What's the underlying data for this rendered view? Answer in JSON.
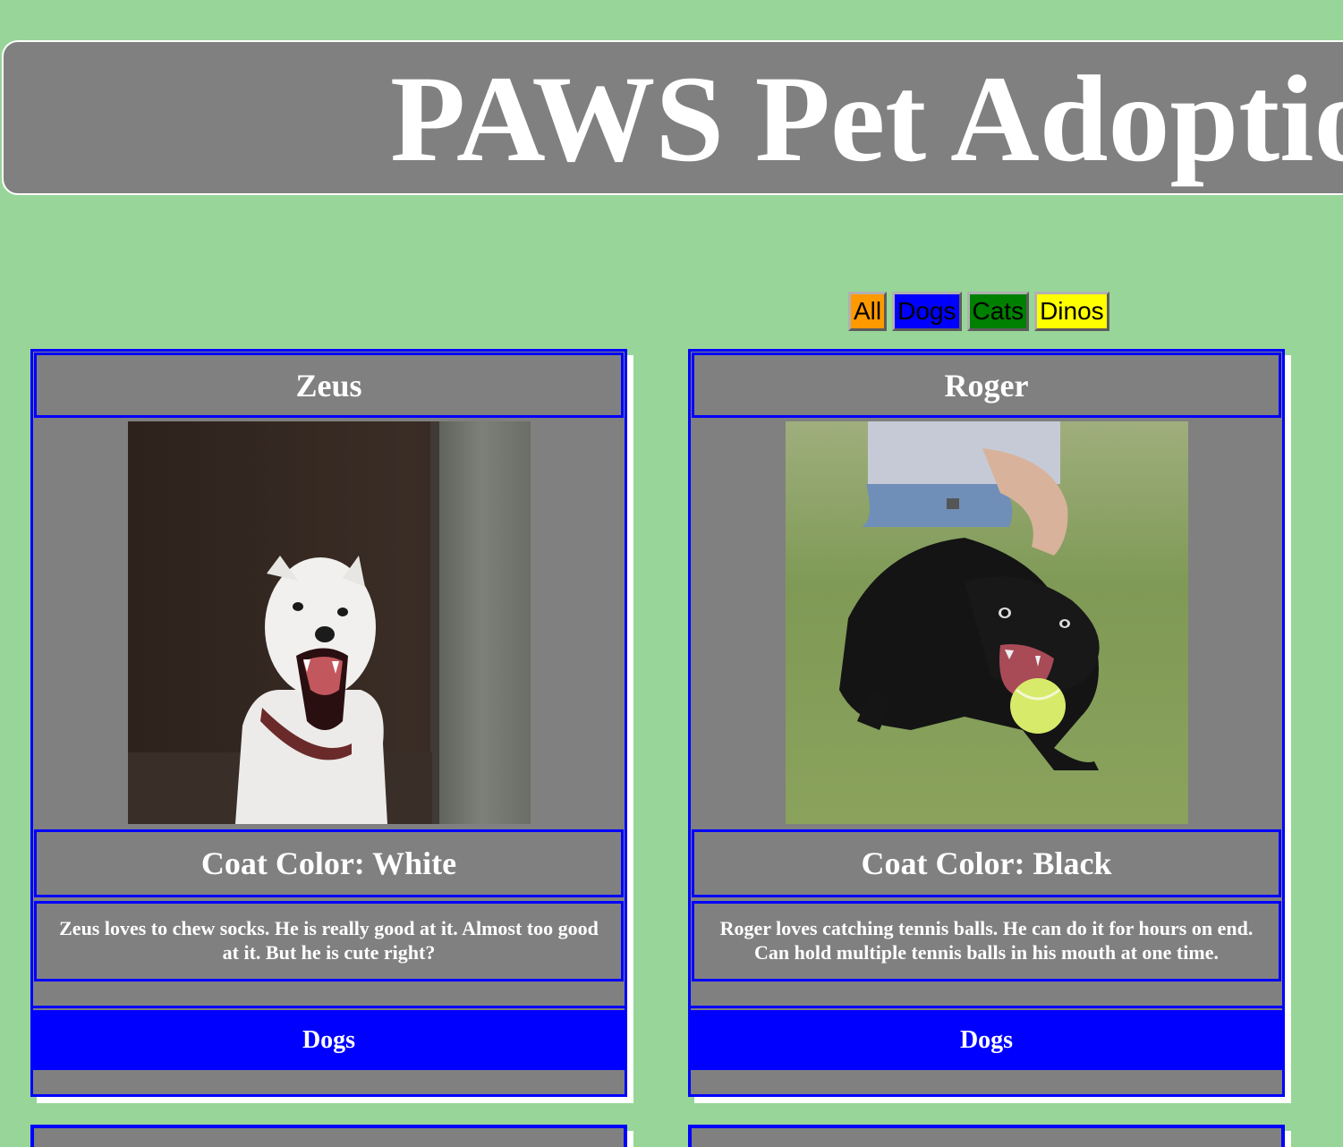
{
  "header": {
    "title": "PAWS Pet Adoption"
  },
  "filters": [
    {
      "label": "All",
      "color": "#ff9900"
    },
    {
      "label": "Dogs",
      "color": "#0000ff"
    },
    {
      "label": "Cats",
      "color": "#008000"
    },
    {
      "label": "Dinos",
      "color": "#ffff00"
    }
  ],
  "pets": [
    {
      "name": "Zeus",
      "photo": "white-dog-photo",
      "coat_color": "Coat Color: White",
      "description": "Zeus loves to chew socks. He is really good at it. Almost too good at it. But he is cute right?",
      "category": "Dogs"
    },
    {
      "name": "Roger",
      "photo": "black-dog-photo",
      "coat_color": "Coat Color: Black",
      "description": "Roger loves catching tennis balls. He can do it for hours on end. Can hold multiple tennis balls in his mouth at one time.",
      "category": "Dogs"
    }
  ],
  "colors": {
    "background": "#98d598",
    "panel": "#808080",
    "border": "#0000ff"
  }
}
